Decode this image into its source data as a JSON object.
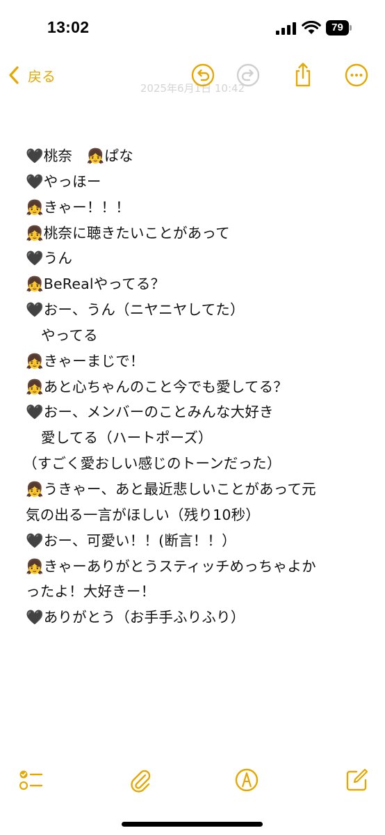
{
  "status_bar": {
    "time": "13:02",
    "battery_level": "79",
    "icons": [
      "signal-icon",
      "wifi-icon",
      "battery-icon"
    ]
  },
  "toolbar": {
    "back_label": "戻る",
    "icons": [
      "chevron-left-icon",
      "undo-icon",
      "redo-icon",
      "share-icon",
      "more-icon"
    ],
    "accent_color": "#e5a800"
  },
  "note": {
    "date_hint": "2025年6月1日 10:42",
    "lines": [
      "🖤桃奈　👧ぱな",
      "🖤やっほー",
      "👧きゃー！！！",
      "👧桃奈に聴きたいことがあって",
      "🖤うん",
      "👧BeRealやってる？",
      "🖤おー、うん（ニヤニヤしてた）",
      "やってる",
      "👧きゃーまじで！",
      "👧あと心ちゃんのこと今でも愛してる？",
      "🖤おー、メンバーのことみんな大好き",
      "愛してる（ハートポーズ）",
      "（すごく愛おしい感じのトーンだった）",
      "👧うきゃー、あと最近悲しいことがあって元",
      "気の出る一言がほしい（残り10秒）",
      "🖤おー、可愛い！！(断言！！）",
      "👧きゃーありがとうスティッチめっちゃよか",
      "ったよ！大好きー！",
      "🖤ありがとう（お手手ふりふり）"
    ]
  },
  "bottom_toolbar": {
    "icons": [
      "checklist-icon",
      "attachment-icon",
      "markup-icon",
      "compose-icon"
    ]
  }
}
